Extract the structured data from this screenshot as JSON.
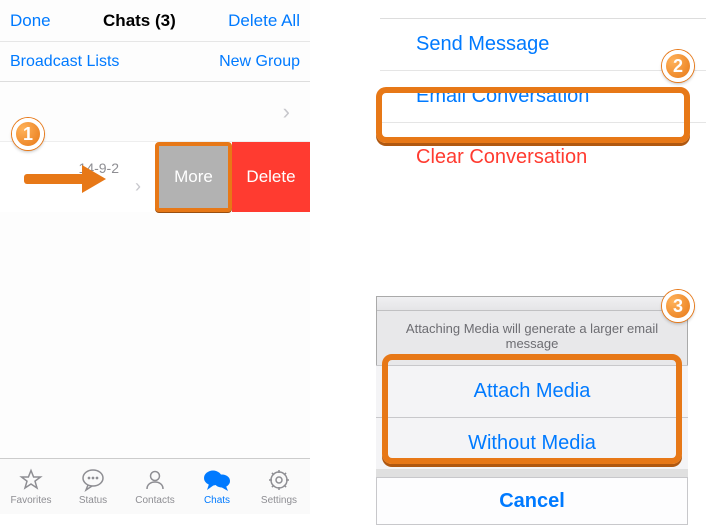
{
  "nav": {
    "done": "Done",
    "title": "Chats (3)",
    "delete_all": "Delete All"
  },
  "subnav": {
    "broadcast": "Broadcast Lists",
    "new_group": "New Group"
  },
  "chat_row": {
    "date": "14-9-2",
    "more": "More",
    "delete": "Delete"
  },
  "tabs": {
    "favorites": "Favorites",
    "status": "Status",
    "contacts": "Contacts",
    "chats": "Chats",
    "settings": "Settings"
  },
  "menu": {
    "send": "Send Message",
    "email": "Email Conversation",
    "clear": "Clear Conversation"
  },
  "sheet": {
    "message": "Attaching Media will generate a larger email message",
    "attach": "Attach Media",
    "without": "Without Media",
    "cancel": "Cancel"
  },
  "steps": {
    "s1": "1",
    "s2": "2",
    "s3": "3"
  }
}
